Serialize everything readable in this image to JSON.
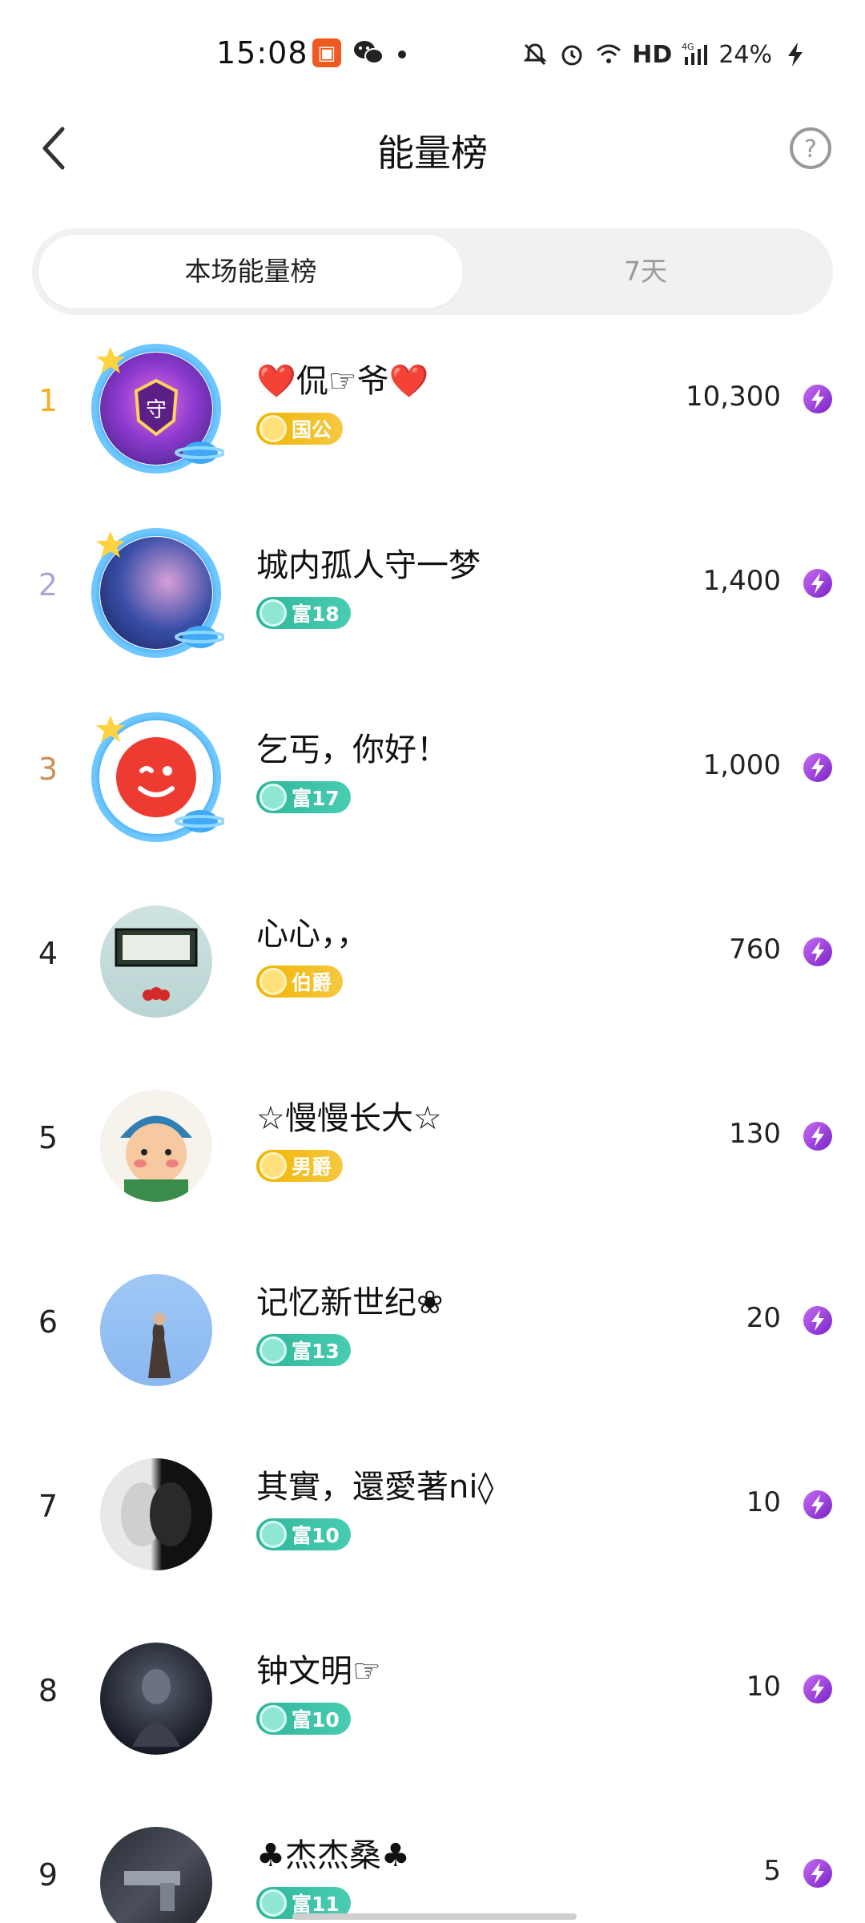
{
  "status_bar": {
    "time": "15:08",
    "app1_icon": "kuaishou-icon",
    "app2_icon": "wechat-icon",
    "network": "HD",
    "signal": "4G",
    "battery": "24%"
  },
  "header": {
    "title": "能量榜",
    "back_icon": "back-arrow-icon",
    "help_icon": "help-icon"
  },
  "tabs": [
    {
      "label": "本场能量榜",
      "active": true
    },
    {
      "label": "7天",
      "active": false
    }
  ],
  "rows": [
    {
      "rank": "1",
      "name": "❤️侃☞爷❤️",
      "badge": "国公",
      "badge_type": "gold",
      "score": "10,300"
    },
    {
      "rank": "2",
      "name": "城内孤人守一梦",
      "badge": "富18",
      "badge_type": "green",
      "score": "1,400"
    },
    {
      "rank": "3",
      "name": "乞丐，你好！",
      "badge": "富17",
      "badge_type": "green",
      "score": "1,000"
    },
    {
      "rank": "4",
      "name": "心心，，",
      "badge": "伯爵",
      "badge_type": "gold",
      "score": "760"
    },
    {
      "rank": "5",
      "name": "☆慢慢长大☆",
      "badge": "男爵",
      "badge_type": "gold",
      "score": "130"
    },
    {
      "rank": "6",
      "name": "记忆新世纪❀",
      "badge": "富13",
      "badge_type": "green",
      "score": "20"
    },
    {
      "rank": "7",
      "name": "其實，還愛著ni◊",
      "badge": "富10",
      "badge_type": "green",
      "score": "10"
    },
    {
      "rank": "8",
      "name": "钟文明☞",
      "badge": "富10",
      "badge_type": "green",
      "score": "10"
    },
    {
      "rank": "9",
      "name": "♣杰杰桑♣",
      "badge": "富11",
      "badge_type": "green",
      "score": "5"
    }
  ],
  "colors": {
    "rank_gold": "#f3b01c",
    "rank_silver": "#a9a7d6",
    "rank_bronze": "#c99157",
    "energy_purple": "#8e2fd8",
    "badge_gold": "#f0b400",
    "badge_green": "#2fb59a"
  }
}
